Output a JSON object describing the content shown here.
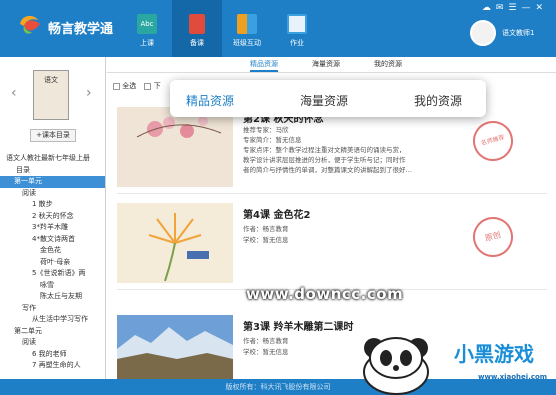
{
  "app": {
    "title": "畅言教学通"
  },
  "nav": [
    {
      "label": "上课",
      "icon": "abc-board-icon",
      "color": "#2aa7a0"
    },
    {
      "label": "备课",
      "icon": "book-icon",
      "color": "#e04b3c"
    },
    {
      "label": "班级互动",
      "icon": "grid-icon",
      "color": "#f0a020"
    },
    {
      "label": "作业",
      "icon": "pencil-note-icon",
      "color": "#3aa0e0"
    }
  ],
  "user": {
    "name": "语文教师1"
  },
  "book": {
    "cover_text": "语文",
    "button": "课本目录"
  },
  "tree": [
    "语文人教社最新七年级上册",
    "目录",
    "第一单元",
    "阅读",
    "1 散步",
    "2 秋天的怀念",
    "3*羚羊木雕",
    "4*散文诗两首",
    "金色花",
    "荷叶·母亲",
    "5《世说新语》两",
    "咏雪",
    "陈太丘与友期",
    "写作",
    "从生活中学习写作",
    "第二单元",
    "阅读",
    "6 我的老师",
    "7 再塑生命的人"
  ],
  "tabs": [
    "精品资源",
    "海量资源",
    "我的资源"
  ],
  "filters": {
    "all": "全选",
    "download": "下"
  },
  "popup": {
    "tabs": [
      "精品资源",
      "海量资源",
      "我的资源"
    ]
  },
  "resources": [
    {
      "title": "第2课 秋天的怀念",
      "lines": [
        "推荐专家：马欣",
        "专家简介：暂无信息",
        "专家点评：整个教学过程注重对文精美语句的诵读与赏，",
        "教学设计讲求层层推进的分析，便于学生听与记；同时作",
        "者的简介与抒情性的单调，对整篇课文的讲解起到了很好…"
      ],
      "stamp": "名师推荐"
    },
    {
      "title": "第4课 金色花2",
      "lines": [
        "作者：畅言教育",
        "学校：暂无信息"
      ],
      "stamp": "原创"
    },
    {
      "title": "第3课 羚羊木雕第二课时",
      "lines": [
        "作者：畅言教育",
        "学校：暂无信息"
      ],
      "stamp": ""
    }
  ],
  "footer": "版权所有：科大讯飞股份有限公司",
  "watermark": {
    "site": "www.downcc.com",
    "brand": "小黑游戏",
    "brand_url": "www.xiaohei.com"
  },
  "colors": {
    "topbar": "#1e7fc6",
    "accent": "#1e7fc6",
    "stamp": "#d9534f"
  }
}
